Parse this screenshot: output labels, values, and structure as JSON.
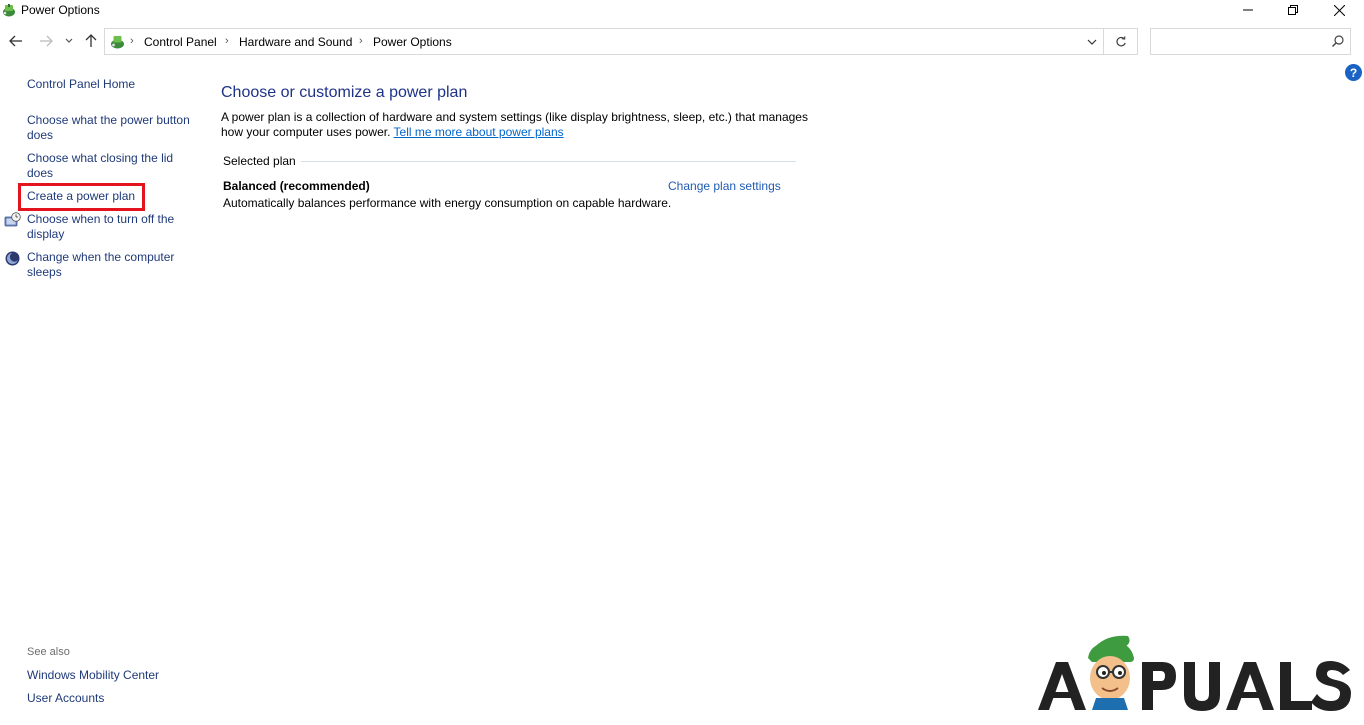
{
  "window": {
    "title": "Power Options",
    "icon": "power-options-icon"
  },
  "navigation": {
    "back_icon": "arrow-left-icon",
    "forward_icon": "arrow-right-icon",
    "recent_icon": "chevron-down-icon",
    "up_icon": "arrow-up-icon",
    "breadcrumb": [
      "Control Panel",
      "Hardware and Sound",
      "Power Options"
    ],
    "refresh_icon": "refresh-icon",
    "search": {
      "value": "",
      "placeholder": ""
    }
  },
  "sidebar": {
    "home": "Control Panel Home",
    "links": [
      {
        "label": "Choose what the power button does",
        "icon": null
      },
      {
        "label": "Choose what closing the lid does",
        "icon": null
      },
      {
        "label": "Create a power plan",
        "icon": null,
        "highlighted": true
      },
      {
        "label": "Choose when to turn off the display",
        "icon": "monitor-clock-icon"
      },
      {
        "label": "Change when the computer sleeps",
        "icon": "moon-icon"
      }
    ],
    "see_also_heading": "See also",
    "see_also": [
      "Windows Mobility Center",
      "User Accounts"
    ]
  },
  "main": {
    "title": "Choose or customize a power plan",
    "description": "A power plan is a collection of hardware and system settings (like display brightness, sleep, etc.) that manages how your computer uses power.",
    "learn_more_link": "Tell me more about power plans",
    "group_label": "Selected plan",
    "plan": {
      "name": "Balanced (recommended)",
      "change_link": "Change plan settings",
      "description": "Automatically balances performance with energy consumption on capable hardware."
    }
  },
  "watermark": {
    "text": "APPUALS"
  },
  "colors": {
    "link": "#1f3a7a",
    "title_blue": "#1e3287",
    "highlight_red": "#e3141e",
    "help_blue": "#1a63c4"
  }
}
